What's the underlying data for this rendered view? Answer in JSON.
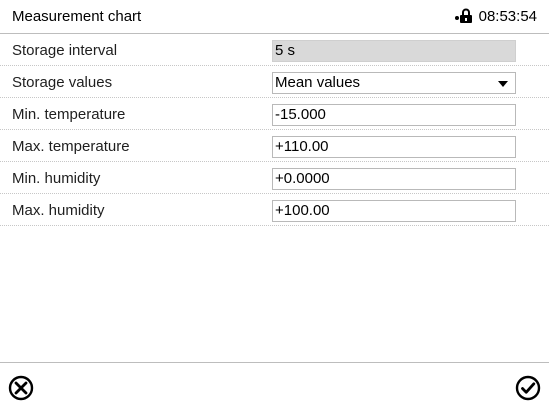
{
  "header": {
    "title": "Measurement chart",
    "time": "08:53:54",
    "lock_icon": "lock-icon"
  },
  "settings": [
    {
      "label": "Storage interval",
      "value": "5 s",
      "type": "readonly"
    },
    {
      "label": "Storage values",
      "value": "Mean values",
      "type": "select"
    },
    {
      "label": "Min. temperature",
      "value": "-15.000",
      "type": "input"
    },
    {
      "label": "Max. temperature",
      "value": "+110.00",
      "type": "input"
    },
    {
      "label": "Min. humidity",
      "value": "+0.0000",
      "type": "input"
    },
    {
      "label": "Max. humidity",
      "value": "+100.00",
      "type": "input"
    }
  ],
  "footer": {
    "cancel_icon": "close-circle-icon",
    "confirm_icon": "check-circle-icon"
  },
  "colors": {
    "readonly_field": "#d9d9d9",
    "field_border": "#b9b9b9",
    "divider": "#bdbdbd"
  }
}
